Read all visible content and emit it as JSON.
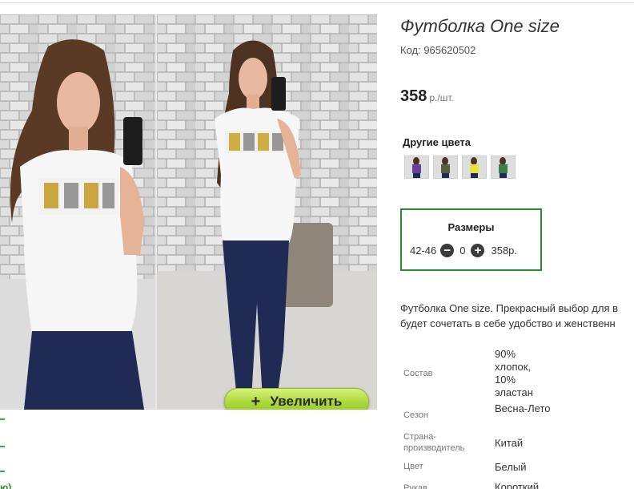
{
  "product": {
    "title": "Футболка One size",
    "code": "Код: 965620502",
    "price": "358",
    "price_unit": "р./шт."
  },
  "gallery": {
    "zoom_label": "Увеличить",
    "zoom_icon": "plus-icon"
  },
  "other_colors": {
    "title": "Другие цвета",
    "swatches": [
      {
        "name": "purple",
        "color": "#6b3fa0"
      },
      {
        "name": "olive",
        "color": "#55603a"
      },
      {
        "name": "yellow",
        "color": "#e8e23a"
      },
      {
        "name": "green",
        "color": "#3b7f47"
      }
    ]
  },
  "sizes": {
    "title": "Размеры",
    "range": "42-46",
    "quantity": "0",
    "price": "358р."
  },
  "description": {
    "line1": "Футболка One size. Прекрасный выбор для в",
    "line2": "будет сочетать в себе удобство и женственн"
  },
  "specs": [
    {
      "name": "Состав",
      "value": "90% хлопок, 10% эластан"
    },
    {
      "name": "Сезон",
      "value": "Весна-Лето"
    },
    {
      "name": "Страна-производитель",
      "value": "Китай"
    },
    {
      "name": "Цвет",
      "value": "Белый"
    },
    {
      "name": "Рукав",
      "value": "Короткий"
    }
  ],
  "side_link_tail": "ю)",
  "colors": {
    "accent_green": "#2d8a2d",
    "zoom_button": "#a8d838"
  }
}
